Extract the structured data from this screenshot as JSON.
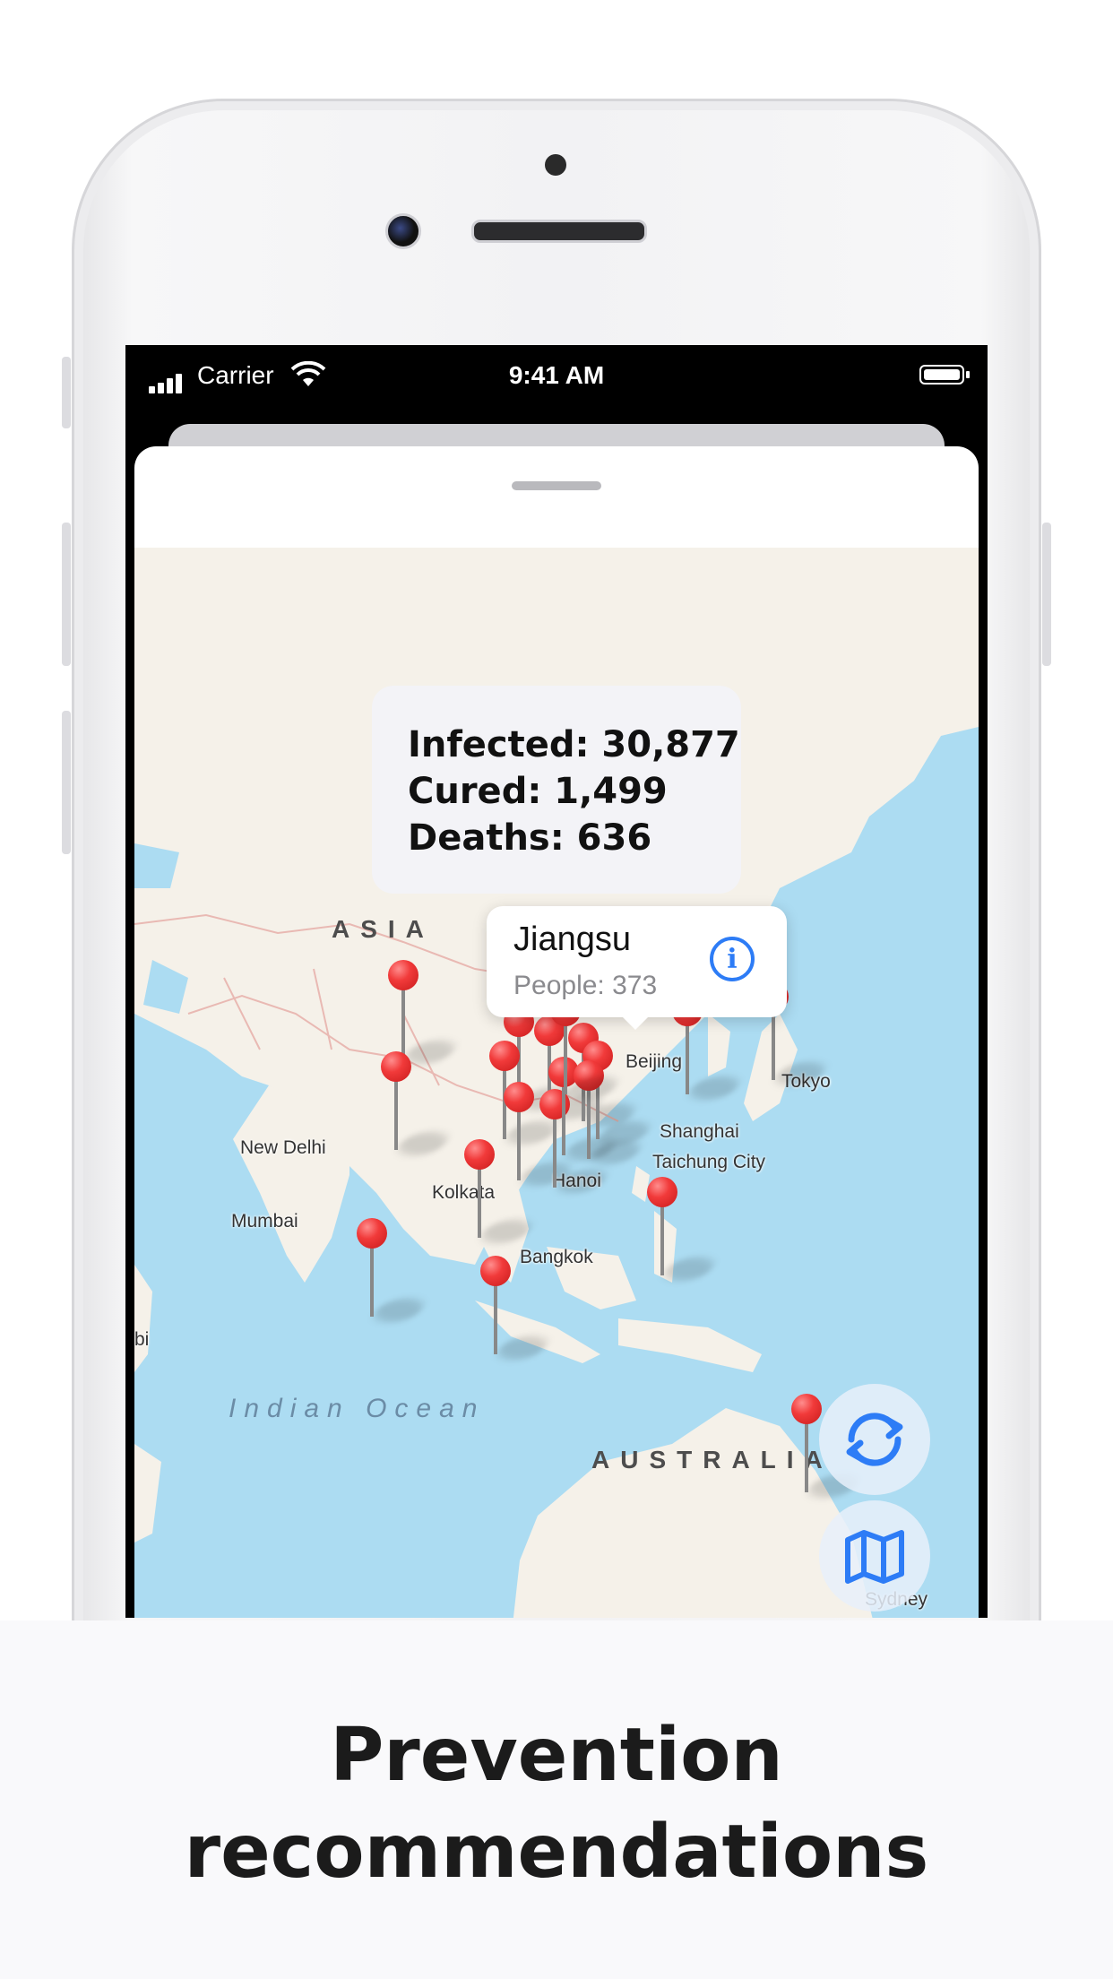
{
  "status_bar": {
    "carrier": "Carrier",
    "time": "9:41 AM"
  },
  "stats": {
    "infected": "Infected: 30,877",
    "cured": "Cured: 1,499",
    "deaths": "Deaths: 636"
  },
  "callout": {
    "title": "Jiangsu",
    "subtitle": "People: 373"
  },
  "map_labels": {
    "asia": "ASIA",
    "australia": "AUSTRALIA",
    "indian_ocean": "Indian Ocean",
    "new_delhi": "New Delhi",
    "kolkata": "Kolkata",
    "mumbai": "Mumbai",
    "hanoi": "Hanoi",
    "bangkok": "Bangkok",
    "shanghai": "Shanghai",
    "tokyo": "Tokyo",
    "taichung": "Taichung City",
    "beijing": "Beijing",
    "sydney": "Sydney",
    "nairobi": "bi"
  },
  "icons": {
    "refresh": "refresh-icon",
    "map": "map-icon",
    "info": "info-icon"
  },
  "colors": {
    "pin": "#f13a3a",
    "accent": "#2d7cf6",
    "ocean": "#acdcf2",
    "land": "#f5f1e9"
  },
  "headline": {
    "line1": "Prevention",
    "line2": "recommendations"
  }
}
